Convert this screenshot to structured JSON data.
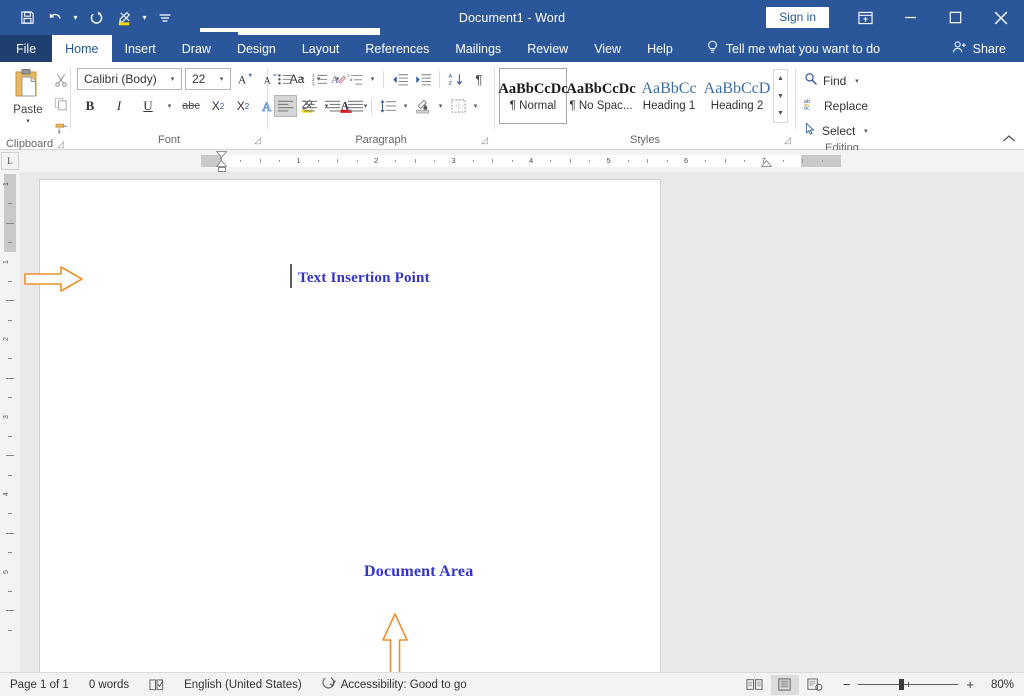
{
  "titlebar": {
    "quick_access": [
      {
        "name": "save-icon",
        "label": "Save"
      },
      {
        "name": "undo-icon",
        "label": "Undo"
      },
      {
        "name": "redo-icon",
        "label": "Repeat"
      },
      {
        "name": "text-highlight-icon",
        "label": "Text Highlight Color"
      },
      {
        "name": "customize-quick-access-icon",
        "label": "Customize Quick Access Toolbar"
      }
    ],
    "document_title": "Document1  -  Word",
    "sign_in": "Sign in",
    "ribbon_display_options": "Ribbon Display Options",
    "minimize": "Minimize",
    "maximize": "Restore Down",
    "close": "Close"
  },
  "tabs": [
    {
      "label": "File",
      "active": false,
      "file": true
    },
    {
      "label": "Home",
      "active": true,
      "file": false
    },
    {
      "label": "Insert",
      "active": false,
      "file": false
    },
    {
      "label": "Draw",
      "active": false,
      "file": false
    },
    {
      "label": "Design",
      "active": false,
      "file": false
    },
    {
      "label": "Layout",
      "active": false,
      "file": false
    },
    {
      "label": "References",
      "active": false,
      "file": false
    },
    {
      "label": "Mailings",
      "active": false,
      "file": false
    },
    {
      "label": "Review",
      "active": false,
      "file": false
    },
    {
      "label": "View",
      "active": false,
      "file": false
    },
    {
      "label": "Help",
      "active": false,
      "file": false
    }
  ],
  "tellme": {
    "label": "Tell me what you want to do",
    "icon": "lightbulb-icon"
  },
  "share": {
    "label": "Share",
    "icon": "share-person-icon"
  },
  "ribbon": {
    "clipboard": {
      "group_label": "Clipboard",
      "paste_label": "Paste",
      "cut_label": "Cut",
      "copy_label": "Copy",
      "format_painter_label": "Format Painter",
      "dialog_launcher": "Clipboard dialog launcher"
    },
    "font": {
      "group_label": "Font",
      "font_name": "Calibri (Body)",
      "font_size": "22",
      "grow_font": "Increase Font Size",
      "shrink_font": "Decrease Font Size",
      "change_case": "Aa",
      "clear_formatting": "Clear All Formatting",
      "bold": "B",
      "italic": "I",
      "underline": "U",
      "strikethrough": "abc",
      "subscript": "X",
      "superscript": "X",
      "text_effects": "A",
      "highlight": "Text Highlight Color",
      "font_color": "A",
      "dialog_launcher": "Font dialog launcher"
    },
    "paragraph": {
      "group_label": "Paragraph",
      "bullets": "Bullets",
      "numbering": "Numbering",
      "multilevel": "Multilevel List",
      "decrease_indent": "Decrease Indent",
      "increase_indent": "Increase Indent",
      "sort": "Sort",
      "show_marks": "¶",
      "align_left": "Align Left",
      "align_center": "Center",
      "align_right": "Align Right",
      "justify": "Justify",
      "line_spacing": "Line and Paragraph Spacing",
      "shading": "Shading",
      "borders": "Borders",
      "dialog_launcher": "Paragraph dialog launcher"
    },
    "styles": {
      "group_label": "Styles",
      "items": [
        {
          "preview": "AaBbCcDc",
          "name": "¶ Normal",
          "selected": true,
          "heading": false
        },
        {
          "preview": "AaBbCcDc",
          "name": "¶ No Spac...",
          "selected": false,
          "heading": false
        },
        {
          "preview": "AaBbCс",
          "name": "Heading 1",
          "selected": false,
          "heading": true
        },
        {
          "preview": "AaBbCcD",
          "name": "Heading 2",
          "selected": false,
          "heading": true
        }
      ],
      "dialog_launcher": "Styles dialog launcher"
    },
    "editing": {
      "group_label": "Editing",
      "find": "Find",
      "replace": "Replace",
      "select": "Select"
    },
    "collapse_ribbon": "Collapse the Ribbon"
  },
  "ruler": {
    "horizontal_numbers": [
      "1",
      "1",
      "2",
      "3",
      "4",
      "5",
      "6",
      "7"
    ],
    "vertical_numbers": [
      "1",
      "1",
      "2",
      "3",
      "4",
      "5"
    ],
    "tab_selector": "L"
  },
  "document": {
    "insertion_point_label": "Text Insertion Point",
    "document_area_label": "Document Area",
    "annotation_color": "#e8912d",
    "label_color": "#3333cc",
    "arrow_right_name": "annotation-arrow-right",
    "arrow_up_name": "annotation-arrow-up"
  },
  "statusbar": {
    "page": "Page 1 of 1",
    "words": "0 words",
    "proofing_icon": "proofing-errors-icon",
    "language": "English (United States)",
    "accessibility": "Accessibility: Good to go",
    "accessibility_icon": "accessibility-icon",
    "views": [
      {
        "name": "read-mode-view",
        "label": "Read Mode",
        "active": false
      },
      {
        "name": "print-layout-view",
        "label": "Print Layout",
        "active": true
      },
      {
        "name": "web-layout-view",
        "label": "Web Layout",
        "active": false
      }
    ],
    "zoom_out": "−",
    "zoom_in": "+",
    "zoom_level": "80%"
  }
}
